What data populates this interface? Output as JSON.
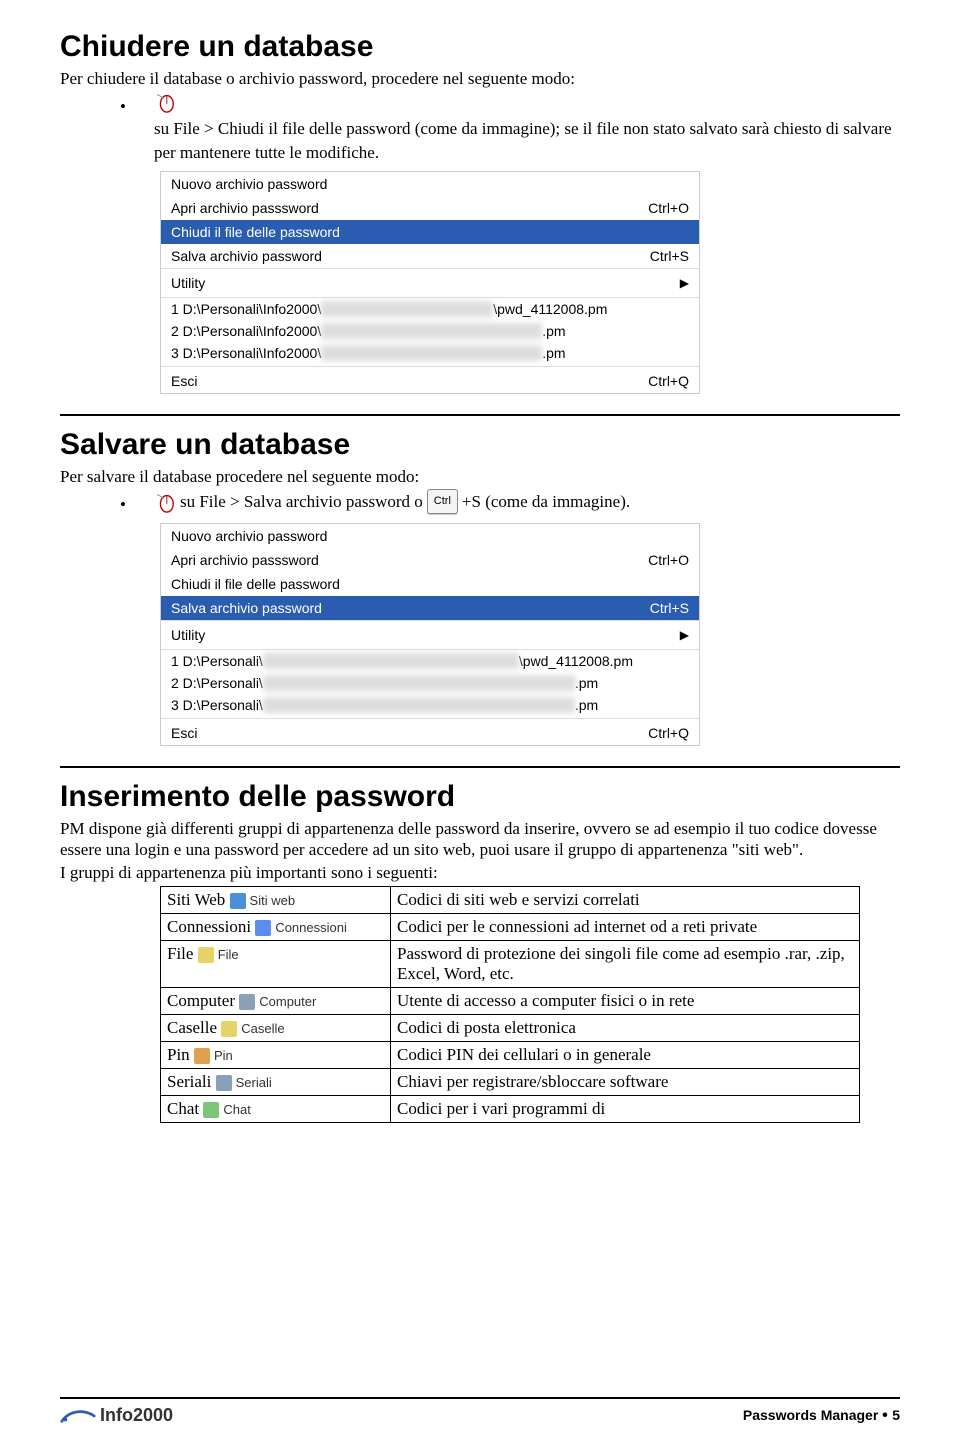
{
  "section1": {
    "title": "Chiudere un database",
    "intro": "Per chiudere il database o archivio password, procedere nel seguente modo:",
    "bullet_pre": "su File > Chiudi il file delle password (come da immagine); se il file non  stato salvato sarà chiesto di salvare per mantenere tutte le modifiche."
  },
  "menu1": {
    "items": [
      {
        "label": "Nuovo archivio password",
        "shortcut": ""
      },
      {
        "label": "Apri archivio passsword",
        "shortcut": "Ctrl+O"
      },
      {
        "label": "Chiudi il file delle password",
        "shortcut": "",
        "selected": true
      },
      {
        "label": "Salva archivio password",
        "shortcut": "Ctrl+S"
      }
    ],
    "utility": "Utility",
    "recents": [
      {
        "prefix": "1 D:\\Personali\\Info2000\\",
        "suffix": "\\pwd_4112008.pm"
      },
      {
        "prefix": "2 D:\\Personali\\Info2000\\",
        "suffix": ".pm"
      },
      {
        "prefix": "3 D:\\Personali\\Info2000\\",
        "suffix": ".pm"
      }
    ],
    "exit": {
      "label": "Esci",
      "shortcut": "Ctrl+Q"
    }
  },
  "section2": {
    "title": "Salvare un database",
    "intro": "Per salvare il database procedere nel seguente modo:",
    "bullet_pre": "su File > Salva archivio password o",
    "ctrl_label": "Ctrl",
    "bullet_post": "+S (come da immagine)."
  },
  "menu2": {
    "items": [
      {
        "label": "Nuovo archivio password",
        "shortcut": ""
      },
      {
        "label": "Apri archivio passsword",
        "shortcut": "Ctrl+O"
      },
      {
        "label": "Chiudi il file delle password",
        "shortcut": ""
      },
      {
        "label": "Salva archivio password",
        "shortcut": "Ctrl+S",
        "selected": true
      }
    ],
    "utility": "Utility",
    "recents": [
      {
        "prefix": "1 D:\\Personali\\",
        "suffix": "\\pwd_4112008.pm"
      },
      {
        "prefix": "2 D:\\Personali\\",
        "suffix": ".pm"
      },
      {
        "prefix": "3 D:\\Personali\\",
        "suffix": ".pm"
      }
    ],
    "exit": {
      "label": "Esci",
      "shortcut": "Ctrl+Q"
    }
  },
  "section3": {
    "title": "Inserimento delle password",
    "para": "PM dispone già differenti gruppi di appartenenza delle password da inserire, ovvero se ad esempio il tuo codice dovesse essere una login e una password per accedere ad un sito web, puoi usare il gruppo  di appartenenza \"siti web\".",
    "lead": "I gruppi di appartenenza più importanti sono i seguenti:",
    "rows": [
      {
        "name": "Siti Web",
        "tag": "Siti web",
        "desc": "Codici di siti web e servizi correlati",
        "color": "#4a90d9"
      },
      {
        "name": "Connessioni",
        "tag": "Connessioni",
        "desc": "Codici per le connessioni ad internet od a reti private",
        "color": "#5b8def"
      },
      {
        "name": "File",
        "tag": "File",
        "desc": "Password di protezione dei singoli file come ad esempio .rar, .zip, Excel, Word, etc.",
        "color": "#e8d36a"
      },
      {
        "name": "Computer",
        "tag": "Computer",
        "desc": "Utente di accesso a computer fisici o in rete",
        "color": "#8aa0b8"
      },
      {
        "name": "Caselle",
        "tag": "Caselle",
        "desc": "Codici di posta elettronica",
        "color": "#e8d36a"
      },
      {
        "name": "Pin",
        "tag": "Pin",
        "desc": "Codici PIN dei cellulari o in generale",
        "color": "#e0a050"
      },
      {
        "name": "Seriali",
        "tag": "Seriali",
        "desc": "Chiavi per registrare/sbloccare software",
        "color": "#8aa0b8"
      },
      {
        "name": "Chat",
        "tag": "Chat",
        "desc": "Codici per i vari programmi di",
        "color": "#7cc67c"
      }
    ]
  },
  "footer": {
    "logo": "Info2000",
    "doc": "Passwords Manager",
    "page": "5"
  }
}
